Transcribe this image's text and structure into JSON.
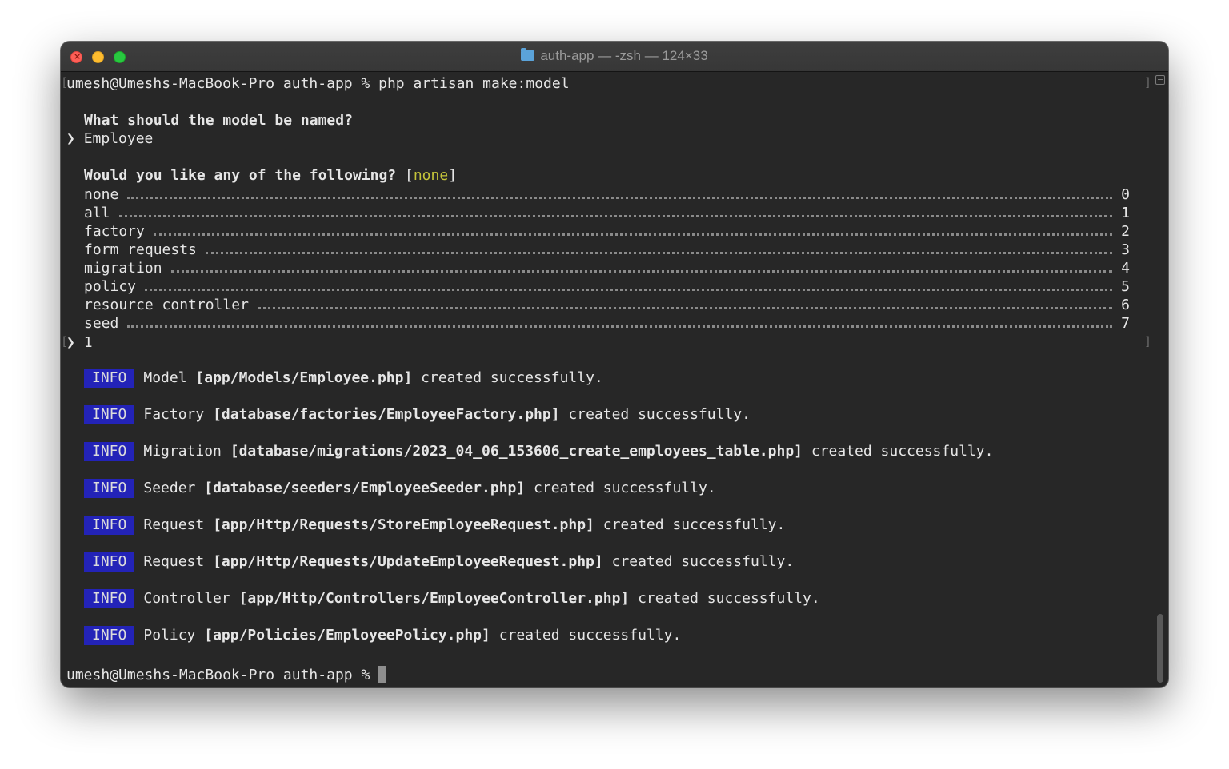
{
  "window": {
    "title": "auth-app — -zsh — 124×33",
    "title_icon": "folder-icon"
  },
  "colors": {
    "background": "#272727",
    "foreground": "#e6e6e6",
    "info_badge": "#2323b8",
    "default_hint": "#c5c43a"
  },
  "terminal": {
    "command_line": "umesh@Umeshs-MacBook-Pro auth-app % php artisan make:model",
    "model_question": "What should the model be named?",
    "prompt_arrow": "❯",
    "model_answer": "Employee",
    "options_question": "Would you like any of the following?",
    "options_default_open": "[",
    "options_default_value": "none",
    "options_default_close": "]",
    "options": [
      {
        "label": "none",
        "index": "0"
      },
      {
        "label": "all",
        "index": "1"
      },
      {
        "label": "factory",
        "index": "2"
      },
      {
        "label": "form requests",
        "index": "3"
      },
      {
        "label": "migration",
        "index": "4"
      },
      {
        "label": "policy",
        "index": "5"
      },
      {
        "label": "resource controller",
        "index": "6"
      },
      {
        "label": "seed",
        "index": "7"
      }
    ],
    "options_answer": "1",
    "info_badge": "INFO",
    "info_lines": [
      {
        "kind": "Model",
        "path": "[app/Models/Employee.php]",
        "status": "created successfully."
      },
      {
        "kind": "Factory",
        "path": "[database/factories/EmployeeFactory.php]",
        "status": "created successfully."
      },
      {
        "kind": "Migration",
        "path": "[database/migrations/2023_04_06_153606_create_employees_table.php]",
        "status": "created successfully."
      },
      {
        "kind": "Seeder",
        "path": "[database/seeders/EmployeeSeeder.php]",
        "status": "created successfully."
      },
      {
        "kind": "Request",
        "path": "[app/Http/Requests/StoreEmployeeRequest.php]",
        "status": "created successfully."
      },
      {
        "kind": "Request",
        "path": "[app/Http/Requests/UpdateEmployeeRequest.php]",
        "status": "created successfully."
      },
      {
        "kind": "Controller",
        "path": "[app/Http/Controllers/EmployeeController.php]",
        "status": "created successfully."
      },
      {
        "kind": "Policy",
        "path": "[app/Policies/EmployeePolicy.php]",
        "status": "created successfully."
      }
    ],
    "final_prompt": "umesh@Umeshs-MacBook-Pro auth-app %"
  }
}
